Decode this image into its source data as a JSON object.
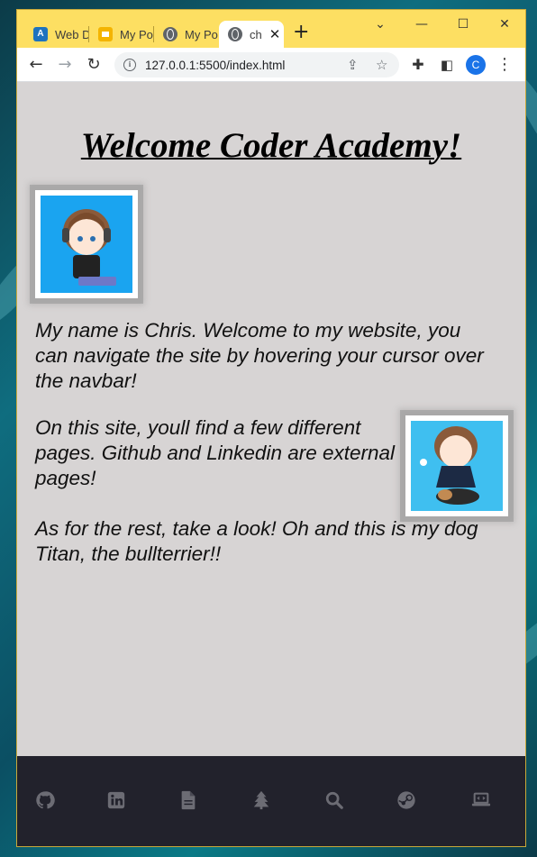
{
  "browser": {
    "tabs": [
      {
        "label": "Web D",
        "favicon": "academy-icon"
      },
      {
        "label": "My Po",
        "favicon": "slides-icon"
      },
      {
        "label": "My Po",
        "favicon": "globe-icon"
      },
      {
        "label": "ch",
        "favicon": "globe-icon",
        "active": true
      }
    ],
    "url": "127.0.0.1:5500/index.html",
    "profile_initial": "C",
    "accent_color": "#fddf62"
  },
  "page": {
    "title": "Welcome Coder Academy!",
    "paragraphs": [
      "My name is Chris. Welcome to my website, you can navigate the site by hovering your cursor over the navbar!",
      "On this site, youll find a few different pages. Github and Linkedin are external pages!",
      "As for the rest, take a look! Oh and this is my dog Titan, the bullterrier!!"
    ],
    "background_color": "#d7d4d4"
  },
  "navbar": {
    "items": [
      "github-icon",
      "linkedin-icon",
      "file-icon",
      "tree-icon",
      "search-icon",
      "steam-icon",
      "laptop-code-icon"
    ],
    "background_color": "#22222c",
    "icon_color": "#6c6c74"
  }
}
